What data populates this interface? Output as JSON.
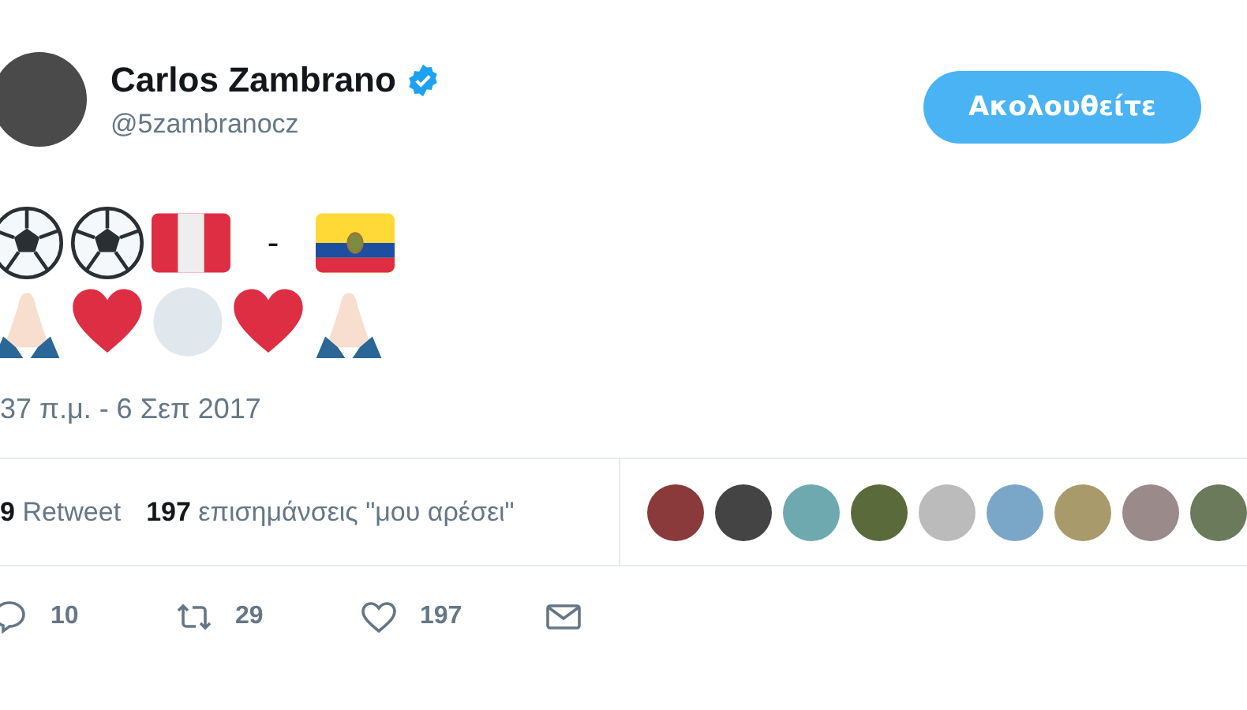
{
  "author": {
    "name": "Carlos Zambrano",
    "verified": true,
    "handle": "@5zambranocz"
  },
  "follow_button": {
    "label": "Ακολουθείτε"
  },
  "tweet_emoji_rows": [
    [
      {
        "kind": "soccer-ball"
      },
      {
        "kind": "soccer-ball"
      },
      {
        "kind": "peru-flag"
      },
      {
        "kind": "dash",
        "text": "-"
      },
      {
        "kind": "ecuador-flag"
      }
    ],
    [
      {
        "kind": "praying-hands"
      },
      {
        "kind": "heart"
      },
      {
        "kind": "white-circle"
      },
      {
        "kind": "heart"
      },
      {
        "kind": "praying-hands"
      }
    ]
  ],
  "timestamp": "37 π.μ. - 6 Σεπ 2017",
  "stats": [
    {
      "count": "9",
      "label": "Retweet"
    },
    {
      "count": "197",
      "label": "επισημάνσεις \"μου αρέσει\""
    }
  ],
  "liker_avatars": [
    {
      "kind": "photo"
    },
    {
      "kind": "photo"
    },
    {
      "kind": "photo"
    },
    {
      "kind": "photo"
    },
    {
      "kind": "photo"
    },
    {
      "kind": "photo"
    },
    {
      "kind": "photo"
    },
    {
      "kind": "photo"
    },
    {
      "kind": "photo"
    }
  ],
  "actions": [
    {
      "kind": "reply",
      "count": "10"
    },
    {
      "kind": "retweet",
      "count": "29"
    },
    {
      "kind": "like",
      "count": "197"
    },
    {
      "kind": "message"
    }
  ]
}
